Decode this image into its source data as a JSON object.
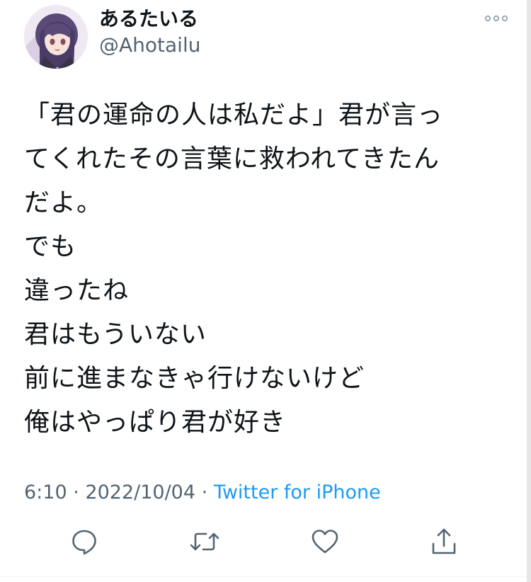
{
  "author": {
    "display_name": "あるたいる",
    "handle": "@Ahotailu",
    "avatar_icon": "anime-avatar-icon"
  },
  "tweet": {
    "lines": [
      "「君の運命の人は私だよ」君が言っ",
      "てくれたその言葉に救われてきたん",
      "だよ。",
      "でも",
      "違ったね",
      "君はもういない",
      "前に進まなきゃ行けないけど",
      "俺はやっぱり君が好き"
    ],
    "time": "6:10",
    "date": "2022/10/04",
    "separator": "·",
    "source": "Twitter for iPhone"
  },
  "actions": {
    "reply_icon": "reply-icon",
    "retweet_icon": "retweet-icon",
    "like_icon": "like-icon",
    "share_icon": "share-icon"
  },
  "colors": {
    "text": "#0f1419",
    "secondary": "#536471",
    "link": "#1d9bf0",
    "icon": "#536471"
  }
}
